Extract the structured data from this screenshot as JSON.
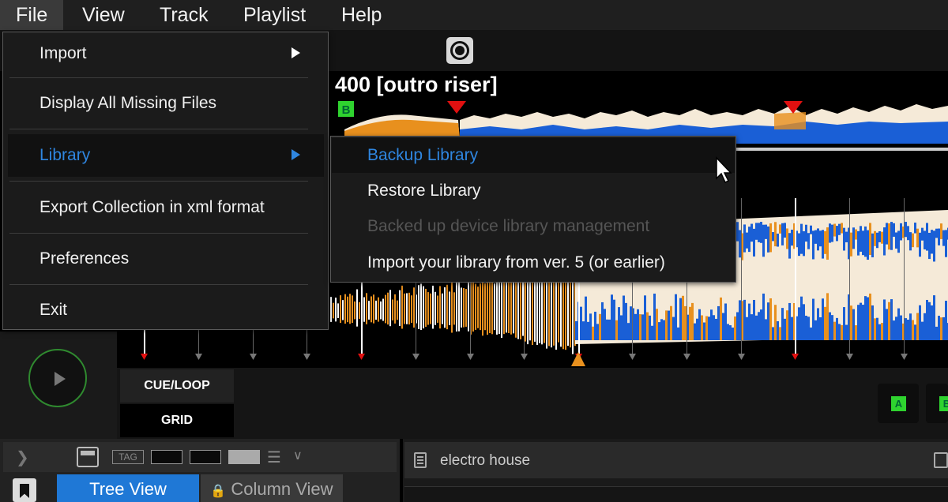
{
  "menubar": {
    "items": [
      "File",
      "View",
      "Track",
      "Playlist",
      "Help"
    ]
  },
  "file_menu": {
    "items": [
      {
        "label": "Import",
        "has_submenu": true
      },
      {
        "label": "Display All Missing Files",
        "has_submenu": false
      },
      {
        "label": "Library",
        "has_submenu": true,
        "active": true
      },
      {
        "label": "Export Collection in xml format",
        "has_submenu": false
      },
      {
        "label": "Preferences",
        "has_submenu": false
      },
      {
        "label": "Exit",
        "has_submenu": false
      }
    ]
  },
  "library_submenu": {
    "items": [
      {
        "label": "Backup Library",
        "state": "hover"
      },
      {
        "label": "Restore Library",
        "state": "enabled"
      },
      {
        "label": "Backed up device library management",
        "state": "disabled"
      },
      {
        "label": "Import your library from ver. 5 (or earlier)",
        "state": "enabled"
      }
    ]
  },
  "deck": {
    "track_title": "400 [outro riser]",
    "overview_marker": "B",
    "tab_cue_loop": "CUE/LOOP",
    "tab_grid": "GRID",
    "hotcues": [
      "A",
      "B"
    ]
  },
  "browser": {
    "toolbar_tag": "TAG",
    "tab_tree": "Tree View",
    "tab_column": "Column View",
    "playlist_name": "electro house"
  },
  "colors": {
    "accent_blue": "#1f78d6",
    "menu_highlight": "#2f86e0",
    "wave_blue": "#1a5fd6",
    "wave_orange": "#e8901e",
    "wave_cream": "#f5ead8",
    "cue_red": "#e01010",
    "hotcue_green": "#2fd32f"
  }
}
